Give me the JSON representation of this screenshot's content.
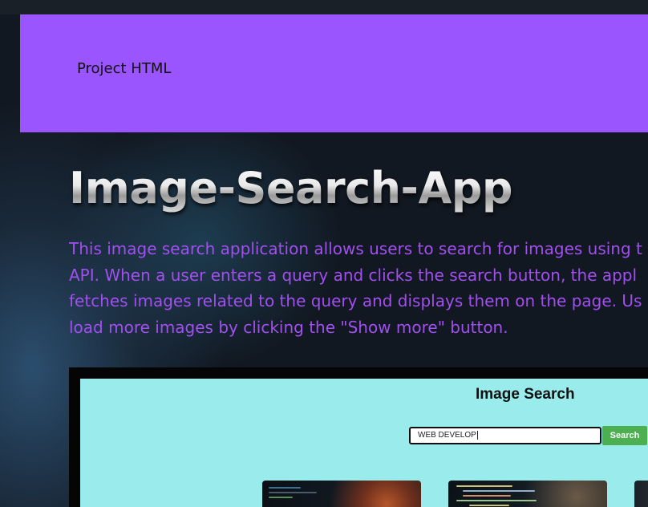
{
  "header": {
    "title": "Project HTML",
    "background_color": "#9a55fe"
  },
  "main": {
    "title": "Image-Search-App",
    "description_lines": [
      "This image search application allows users to search for images using t",
      "API. When a user enters a query and clicks the search button, the appl",
      "fetches images related to the query and displays them on the page. Us",
      "load more images by clicking the \"Show more\" button."
    ],
    "description_color": "#a24ff0"
  },
  "preview": {
    "heading": "Image Search",
    "search_value": "WEB DEVELOP",
    "search_button_label": "Search",
    "background_color": "#9aebec",
    "button_color": "#4caf50",
    "thumbnails": [
      {
        "name": "coding-photo-thumbnail"
      },
      {
        "name": "code-screen-thumbnail"
      },
      {
        "name": "partial-thumbnail"
      }
    ]
  }
}
